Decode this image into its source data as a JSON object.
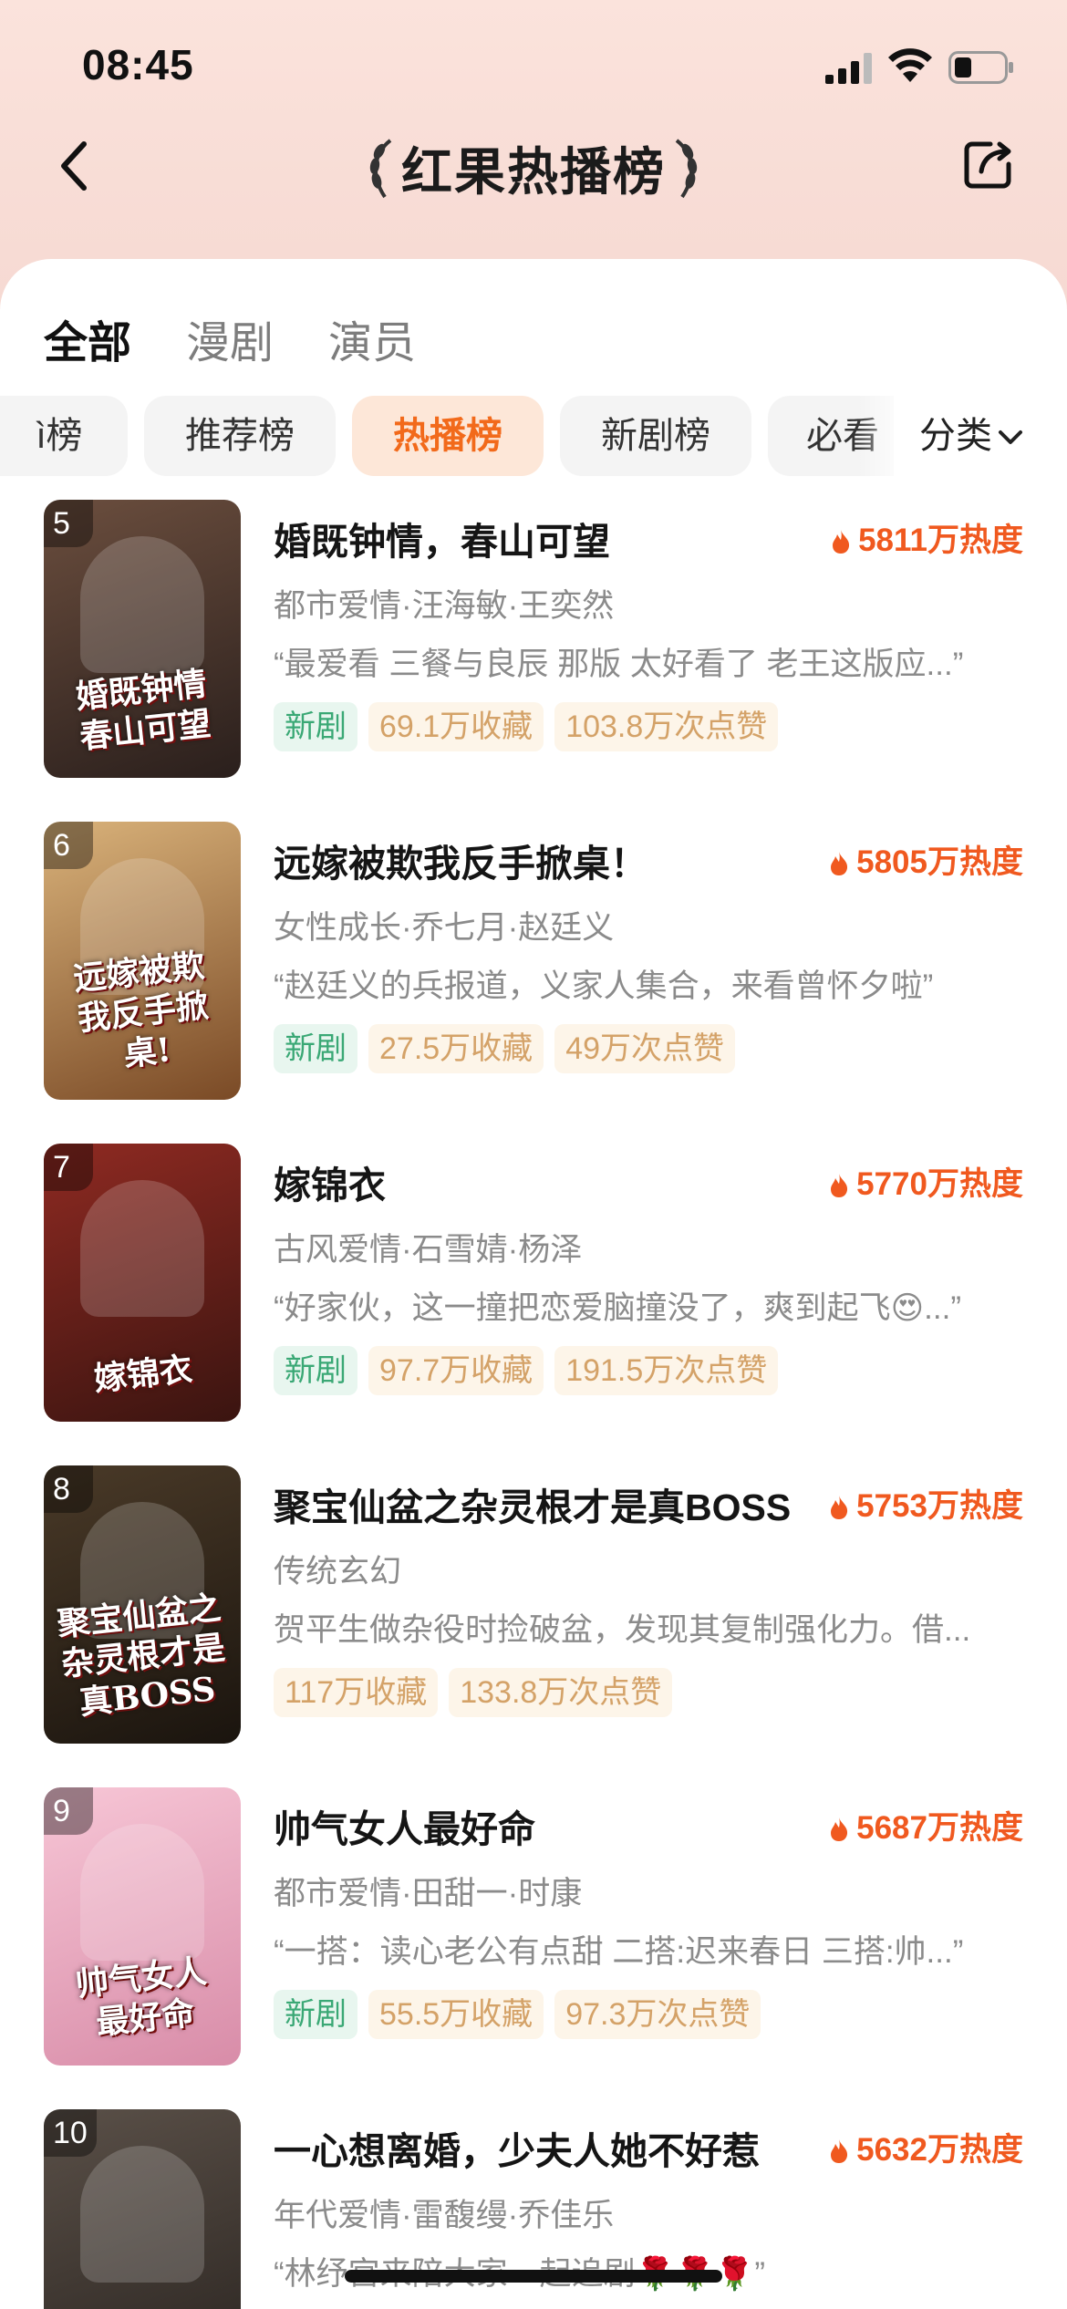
{
  "status_bar": {
    "time": "08:45"
  },
  "header": {
    "title": "红果热播榜"
  },
  "tabs": [
    {
      "label": "全部",
      "active": true
    },
    {
      "label": "漫剧",
      "active": false
    },
    {
      "label": "演员",
      "active": false
    }
  ],
  "chips": [
    {
      "label": "ì榜",
      "selected": false
    },
    {
      "label": "推荐榜",
      "selected": false
    },
    {
      "label": "热播榜",
      "selected": true
    },
    {
      "label": "新剧榜",
      "selected": false
    },
    {
      "label": "必看",
      "selected": false
    }
  ],
  "category_label": "分类",
  "items": [
    {
      "rank": "5",
      "title": "婚既钟情，春山可望",
      "heat": "5811万热度",
      "meta": "都市爱情·汪海敏·王奕然",
      "quote": "“最爱看 三餐与良辰 那版 太好看了 老王这版应...”",
      "tags": [
        "新剧",
        "69.1万收藏",
        "103.8万次点赞"
      ],
      "poster_text": "婚既钟情\n春山可望",
      "poster_colors": [
        "#6b4e3e",
        "#2a1f1c"
      ]
    },
    {
      "rank": "6",
      "title": "远嫁被欺我反手掀桌！",
      "heat": "5805万热度",
      "meta": "女性成长·乔七月·赵廷义",
      "quote": "“赵廷义的兵报道，义家人集合，来看曾怀夕啦”",
      "tags": [
        "新剧",
        "27.5万收藏",
        "49万次点赞"
      ],
      "poster_text": "远嫁被欺\n我反手掀桌!",
      "poster_colors": [
        "#d9b27a",
        "#7a4a26"
      ]
    },
    {
      "rank": "7",
      "title": "嫁锦衣",
      "heat": "5770万热度",
      "meta": "古风爱情·石雪婧·杨泽",
      "quote": "“好家伙，这一撞把恋爱脑撞没了，爽到起飞😍...”",
      "tags": [
        "新剧",
        "97.7万收藏",
        "191.5万次点赞"
      ],
      "poster_text": "嫁锦衣",
      "poster_colors": [
        "#8f2a22",
        "#3a1410"
      ]
    },
    {
      "rank": "8",
      "title": "聚宝仙盆之杂灵根才是真BOSS",
      "heat": "5753万热度",
      "meta": "传统玄幻",
      "quote": "贺平生做杂役时捡破盆，发现其复制强化力。借...",
      "tags": [
        "117万收藏",
        "133.8万次点赞"
      ],
      "poster_text": "聚宝仙盆之\n杂灵根才是真BOSS",
      "poster_colors": [
        "#4a3a28",
        "#1a140e"
      ]
    },
    {
      "rank": "9",
      "title": "帅气女人最好命",
      "heat": "5687万热度",
      "meta": "都市爱情·田甜一·时康",
      "quote": "“一搭：读心老公有点甜 二搭:迟来春日 三搭:帅...”",
      "tags": [
        "新剧",
        "55.5万收藏",
        "97.3万次点赞"
      ],
      "poster_text": "帅气女人\n最好命",
      "poster_colors": [
        "#f7c6d6",
        "#d88ca8"
      ]
    },
    {
      "rank": "10",
      "title": "一心想离婚，少夫人她不好惹",
      "heat": "5632万热度",
      "meta": "年代爱情·雷馥缦·乔佳乐",
      "quote": "“林纾宫来陪大家一起追剧🌹🌹🌹”",
      "tags": [],
      "poster_text": "",
      "poster_colors": [
        "#5a5048",
        "#2a2420"
      ]
    }
  ],
  "colors": {
    "accent": "#f26a1b",
    "heat": "#f0591f",
    "new_tag": "#3aa875",
    "stat_tag": "#d4a268"
  },
  "icons": {
    "back": "chevron-left-icon",
    "share": "share-icon",
    "heat": "flame-icon",
    "category": "chevron-down-icon"
  }
}
